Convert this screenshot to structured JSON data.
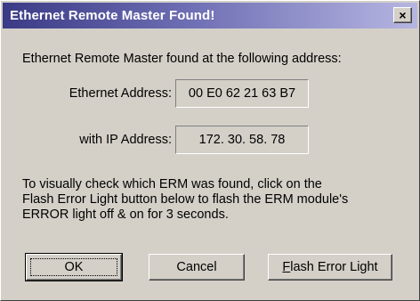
{
  "dialog": {
    "title": "Ethernet Remote Master Found!",
    "close_label": "×",
    "intro": "Ethernet Remote Master found at the following address:",
    "ethernet_label": "Ethernet Address:",
    "ethernet_value": "00 E0 62 21 63 B7",
    "ip_label": "with IP Address:",
    "ip_value": "172. 30. 58. 78",
    "description_lines": [
      "To visually check which ERM was found, click on the",
      "Flash Error Light button below to flash the ERM module's",
      "ERROR light off & on for 3 seconds."
    ],
    "buttons": {
      "ok": "OK",
      "cancel": "Cancel",
      "flash_first_letter": "F",
      "flash_rest": "lash Error Light"
    }
  }
}
